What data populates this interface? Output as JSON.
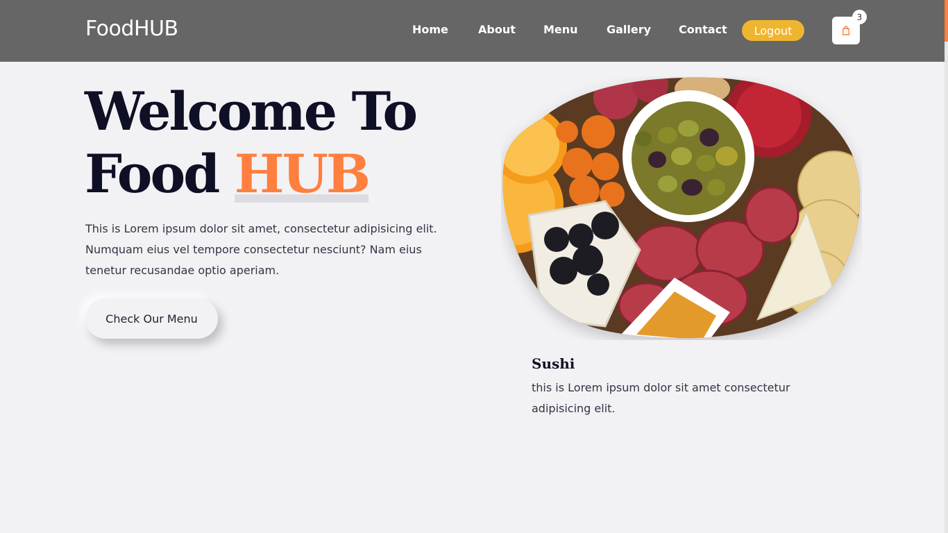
{
  "header": {
    "brand": "FoodHUB",
    "nav": [
      {
        "label": "Home"
      },
      {
        "label": "About"
      },
      {
        "label": "Menu"
      },
      {
        "label": "Gallery"
      },
      {
        "label": "Contact"
      }
    ],
    "logout_label": "Logout",
    "cart_icon": "shopping-bag-icon",
    "cart_count": "3"
  },
  "hero": {
    "title_line1": "Welcome To",
    "title_line2_prefix": "Food",
    "title_line2_accent": "HUB",
    "description": "This is Lorem ipsum dolor sit amet, consectetur adipisicing elit. Numquam eius vel tempore consectetur nesciunt? Nam eius tenetur recusandae optio aperiam.",
    "cta_label": "Check Our Menu"
  },
  "featured": {
    "title": "Sushi",
    "description": "this is Lorem ipsum dolor sit amet consectetur adipisicing elit."
  },
  "colors": {
    "accent": "#ff7f3e",
    "navbar": "#666666",
    "logout": "#f0b52e",
    "heading": "#0f0f25",
    "background": "#f2f2f5"
  }
}
